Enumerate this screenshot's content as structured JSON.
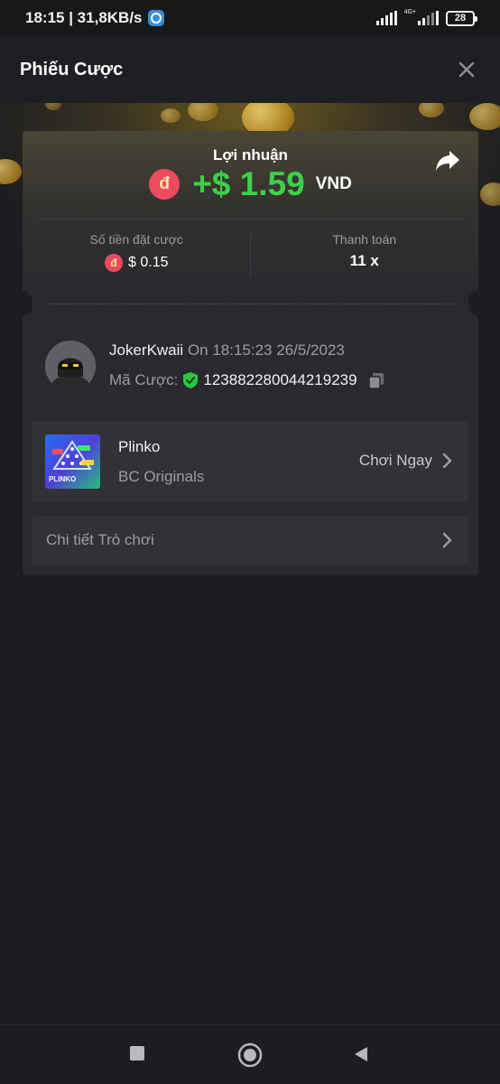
{
  "status_bar": {
    "time_speed": "18:15 | 31,8KB/s",
    "network": "4G+",
    "battery": "28"
  },
  "header": {
    "title": "Phiếu Cược"
  },
  "result": {
    "profit_label": "Lợi nhuận",
    "currency_symbol": "đ",
    "profit_amount": "+$ 1.59",
    "currency": "VND"
  },
  "stats": {
    "bet_amount_label": "Số tiền đặt cược",
    "bet_amount": "$ 0.15",
    "payout_label": "Thanh toán",
    "payout": "11 x"
  },
  "bet": {
    "username": "JokerKwaii",
    "time": "On 18:15:23 26/5/2023",
    "id_label": "Mã Cược:",
    "id": "123882280044219239"
  },
  "game": {
    "name": "Plinko",
    "provider": "BC Originals",
    "play_label": "Chơi Ngay",
    "thumb_label": "PLINKO"
  },
  "details": {
    "label": "Chi tiết Trò chơi"
  },
  "colors": {
    "profit_green": "#3dd14a",
    "currency_red": "#ec4a5f",
    "verified_green": "#27c93f"
  }
}
